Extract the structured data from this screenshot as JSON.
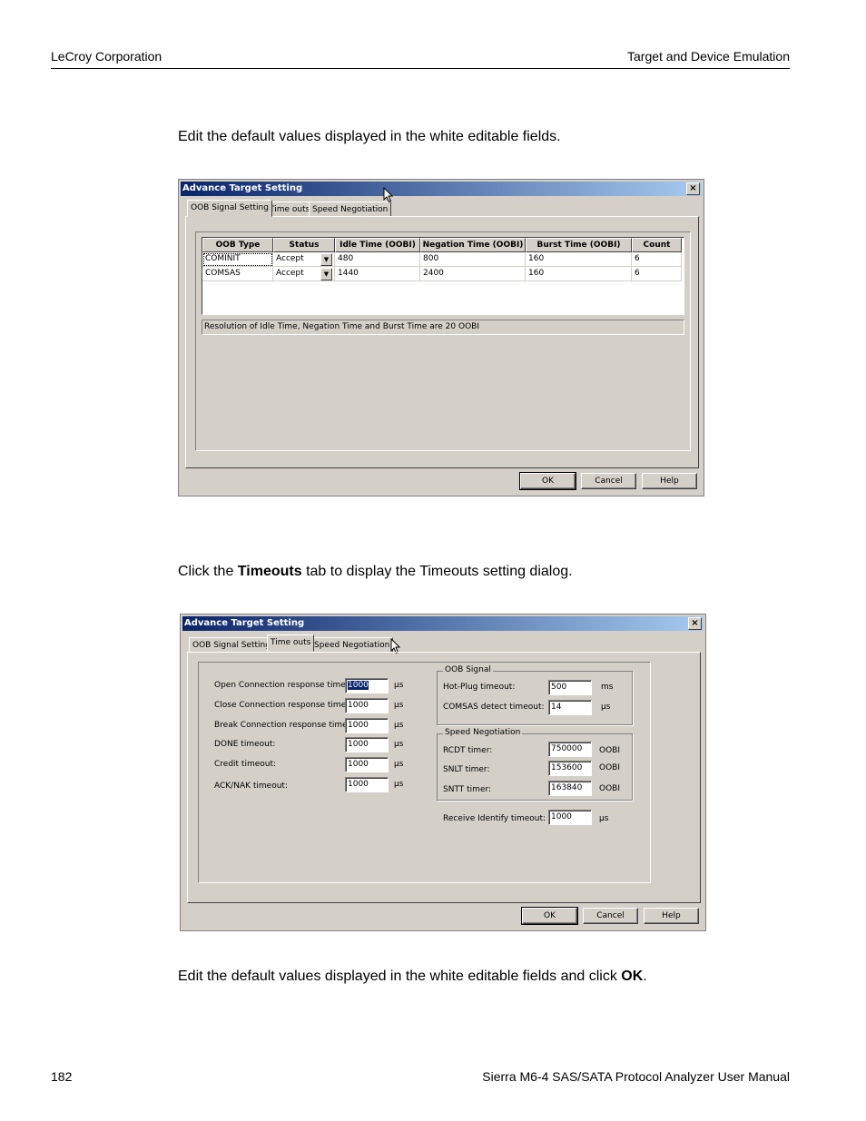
{
  "header": {
    "left": "LeCroy Corporation",
    "right": "Target and Device Emulation"
  },
  "para1": "Edit the default values displayed in the white editable fields.",
  "para2": {
    "pre": "Click the ",
    "bold": "Timeouts",
    "post": " tab to display the Timeouts setting dialog."
  },
  "para3": {
    "pre": "Edit the default values displayed in the white editable fields and click ",
    "bold": "OK",
    "post": "."
  },
  "footer": {
    "page": "182",
    "manual": "Sierra M6-4 SAS/SATA Protocol Analyzer User Manual"
  },
  "dialog1": {
    "title": "Advance Target Setting",
    "close": "×",
    "tabs": [
      "OOB Signal Setting",
      "Time outs",
      "Speed Negotiation"
    ],
    "columns": [
      "OOB Type",
      "Status",
      "Idle Time (OOBI)",
      "Negation Time (OOBI)",
      "Burst Time (OOBI)",
      "Count"
    ],
    "rows": [
      [
        "COMINIT",
        "Accept",
        "480",
        "800",
        "160",
        "6"
      ],
      [
        "COMSAS",
        "Accept",
        "1440",
        "2400",
        "160",
        "6"
      ]
    ],
    "status": "Resolution of Idle Time, Negation Time and Burst Time are 20 OOBI",
    "buttons": {
      "ok": "OK",
      "cancel": "Cancel",
      "help": "Help"
    }
  },
  "dialog2": {
    "title": "Advance Target Setting",
    "close": "×",
    "tabs": [
      "OOB Signal Setting",
      "Time outs",
      "Speed Negotiation"
    ],
    "left_fields": [
      {
        "label": "Open Connection response timeout:",
        "value": "1000",
        "unit": "µs"
      },
      {
        "label": "Close Connection response timeout:",
        "value": "1000",
        "unit": "µs"
      },
      {
        "label": "Break Connection response timeout:",
        "value": "1000",
        "unit": "µs"
      },
      {
        "label": "DONE timeout:",
        "value": "1000",
        "unit": "µs"
      },
      {
        "label": "Credit timeout:",
        "value": "1000",
        "unit": "µs"
      },
      {
        "label": "ACK/NAK timeout:",
        "value": "1000",
        "unit": "µs"
      }
    ],
    "oob_group": {
      "title": "OOB Signal",
      "fields": [
        {
          "label": "Hot-Plug timeout:",
          "value": "500",
          "unit": "ms"
        },
        {
          "label": "COMSAS detect timeout:",
          "value": "14",
          "unit": "µs"
        }
      ]
    },
    "speed_group": {
      "title": "Speed Negotiation",
      "fields": [
        {
          "label": "RCDT timer:",
          "value": "750000",
          "unit": "OOBI"
        },
        {
          "label": "SNLT timer:",
          "value": "153600",
          "unit": "OOBI"
        },
        {
          "label": "SNTT timer:",
          "value": "163840",
          "unit": "OOBI"
        }
      ]
    },
    "receive_identify": {
      "label": "Receive Identify timeout:",
      "value": "1000",
      "unit": "µs"
    },
    "buttons": {
      "ok": "OK",
      "cancel": "Cancel",
      "help": "Help"
    }
  }
}
